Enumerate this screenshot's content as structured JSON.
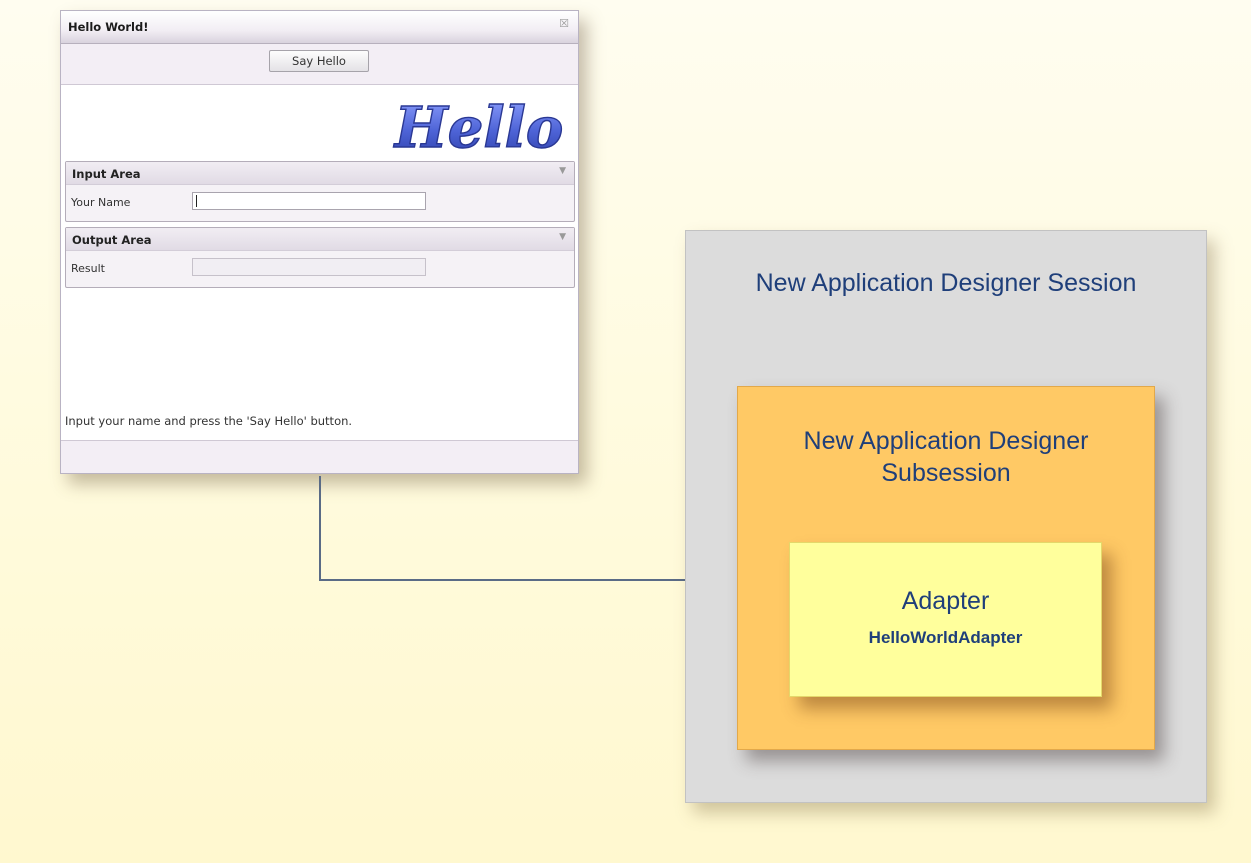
{
  "app_window": {
    "title": "Hello World!",
    "close_icon": "close-icon",
    "toolbar": {
      "say_hello_label": "Say Hello"
    },
    "logo": {
      "text": "Hello",
      "color": "#4d63d6"
    },
    "input_area": {
      "title": "Input Area",
      "name_label": "Your Name",
      "name_value": ""
    },
    "output_area": {
      "title": "Output Area",
      "result_label": "Result",
      "result_value": ""
    },
    "status_text": "Input your name and press the 'Say Hello' button."
  },
  "diagram": {
    "session_label": "New Application Designer Session",
    "subsession_label_line1": "New Application Designer",
    "subsession_label_line2": "Subsession",
    "adapter_label": "Adapter",
    "adapter_name": "HelloWorldAdapter"
  },
  "colors": {
    "background": "#fffbe0",
    "session_fill": "#dcdcdc",
    "subsession_fill": "#ffc965",
    "adapter_fill": "#ffff9c",
    "label_text": "#1f3f7a",
    "connector": "#5a6b86",
    "arrowhead": "#1f3a70"
  }
}
